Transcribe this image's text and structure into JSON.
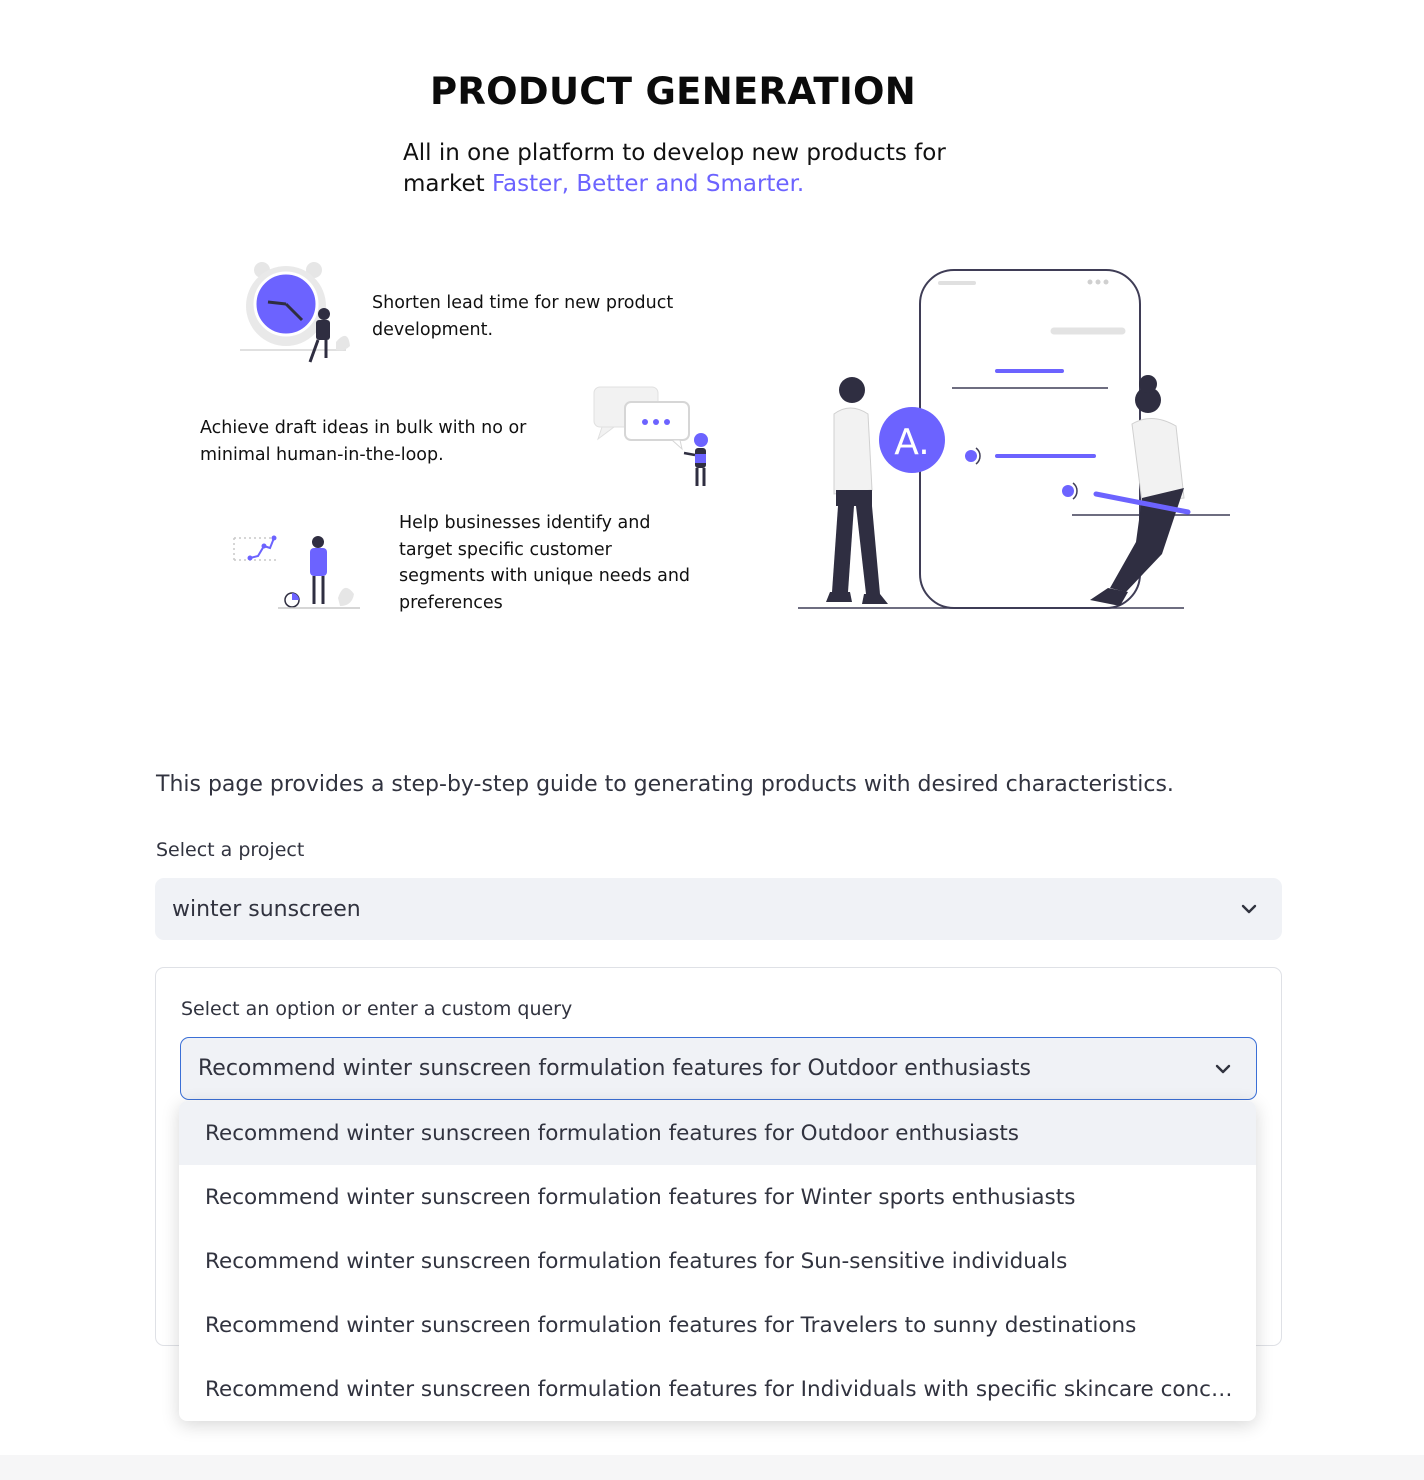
{
  "header": {
    "title": "PRODUCT GENERATION",
    "subtitle_prefix": "All in one platform to develop new products for market ",
    "subtitle_accent": "Faster, Better and Smarter."
  },
  "features": [
    {
      "text": "Shorten lead time for new product development."
    },
    {
      "text": "Achieve draft ideas in bulk with no or minimal human-in-the-loop."
    },
    {
      "text": "Help businesses identify and target specific customer segments with unique needs and preferences"
    }
  ],
  "colors": {
    "accent": "#6c63ff",
    "text": "#31333f",
    "input_bg": "#f0f2f6",
    "focus_border": "#3b6fd6"
  },
  "intro_text": "This page provides a step-by-step guide to generating products with desired characteristics.",
  "project_select": {
    "label": "Select a project",
    "value": "winter sunscreen"
  },
  "query_select": {
    "label": "Select an option or enter a custom query",
    "value": "Recommend winter sunscreen formulation features for Outdoor enthusiasts",
    "options": [
      "Recommend winter sunscreen formulation features for Outdoor enthusiasts",
      "Recommend winter sunscreen formulation features for Winter sports enthusiasts",
      "Recommend winter sunscreen formulation features for Sun-sensitive individuals",
      "Recommend winter sunscreen formulation features for Travelers to sunny destinations",
      "Recommend winter sunscreen formulation features for Individuals with specific skincare conc…"
    ],
    "highlighted_index": 0
  },
  "icons": [
    "clock-illustration",
    "chat-illustration",
    "chart-illustration",
    "phone-people-illustration",
    "chevron-down-icon"
  ]
}
